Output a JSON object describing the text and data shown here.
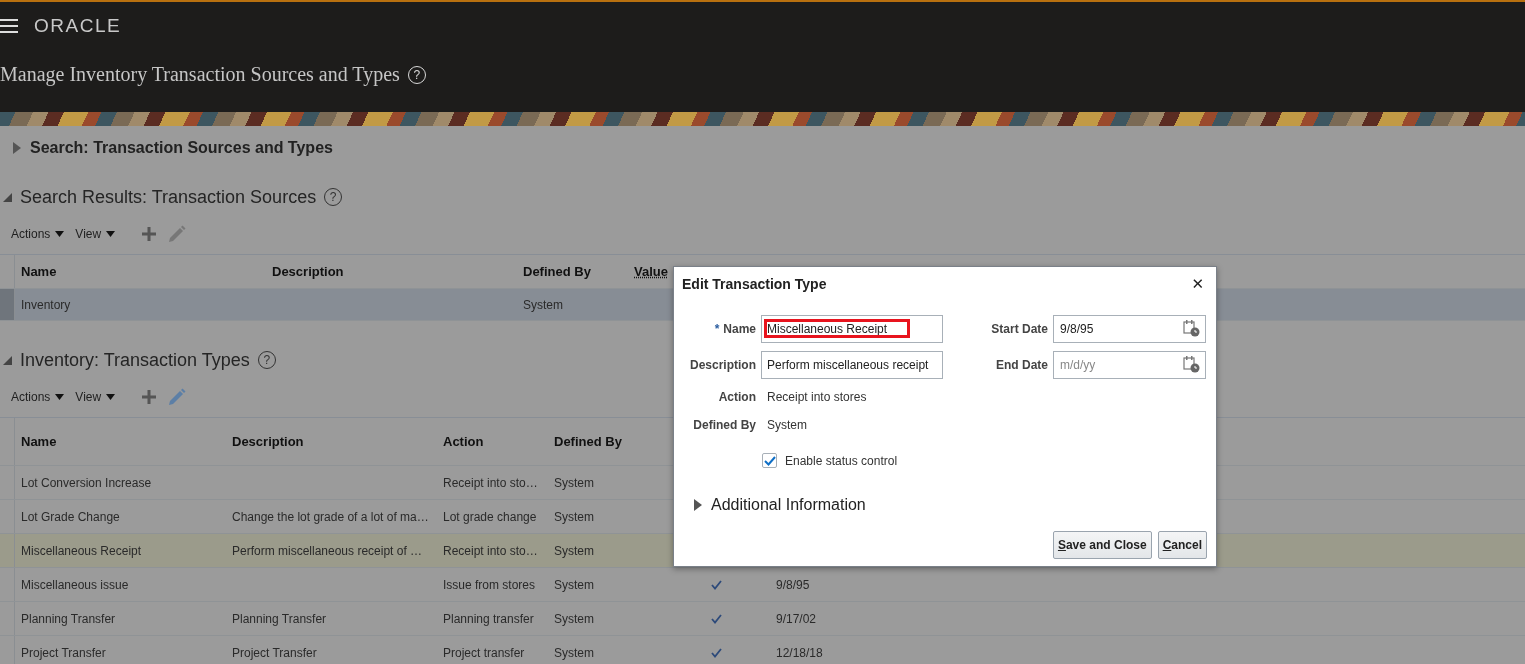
{
  "header": {
    "logo": "ORACLE",
    "page_title": "Manage Inventory Transaction Sources and Types",
    "help": "?"
  },
  "search_section": {
    "title": "Search: Transaction Sources and Types",
    "expanded": false
  },
  "sources": {
    "title": "Search Results: Transaction Sources",
    "help": "?",
    "expanded": true,
    "toolbar": [
      "Actions",
      "View"
    ],
    "columns": [
      "Name",
      "Description",
      "Defined By",
      "Value"
    ],
    "rows": [
      {
        "cells": [
          "Inventory",
          "",
          "System",
          ""
        ],
        "selected": true
      }
    ]
  },
  "types": {
    "title": "Inventory: Transaction Types",
    "help": "?",
    "expanded": true,
    "toolbar": [
      "Actions",
      "View"
    ],
    "columns": [
      "Name",
      "Description",
      "Action",
      "Defined By",
      "",
      ""
    ],
    "rows": [
      {
        "cells": [
          "Lot Conversion Increase",
          "",
          "Receipt into sto…",
          "System"
        ],
        "selected": false
      },
      {
        "cells": [
          "Lot Grade Change",
          "Change the lot grade of a lot of ma…",
          "Lot grade change",
          "System"
        ],
        "selected": false
      },
      {
        "cells": [
          "Miscellaneous Receipt",
          "Perform miscellaneous receipt of …",
          "Receipt into sto…",
          "System"
        ],
        "selected": true
      },
      {
        "cells": [
          "Miscellaneous issue",
          "",
          "Issue from stores",
          "System"
        ],
        "selected": false,
        "status_control": true,
        "start_date": "9/8/95"
      },
      {
        "cells": [
          "Planning Transfer",
          "Planning Transfer",
          "Planning transfer",
          "System"
        ],
        "selected": false,
        "status_control": true,
        "start_date": "9/17/02"
      },
      {
        "cells": [
          "Project Transfer",
          "Project Transfer",
          "Project transfer",
          "System"
        ],
        "selected": false,
        "status_control": true,
        "start_date": "12/18/18"
      }
    ]
  },
  "dialog": {
    "title": "Edit Transaction Type",
    "close": "✕",
    "name": {
      "label": "Name",
      "required_mark": "*",
      "value": "Miscellaneous Receipt",
      "highlighted": true
    },
    "description": {
      "label": "Description",
      "value": "Perform miscellaneous receipt"
    },
    "action": {
      "label": "Action",
      "value": "Receipt into stores"
    },
    "defined_by": {
      "label": "Defined By",
      "value": "System"
    },
    "start_date": {
      "label": "Start Date",
      "value": "9/8/95"
    },
    "end_date": {
      "label": "End Date",
      "placeholder": "m/d/yy"
    },
    "status_control": {
      "label": "Enable status control",
      "checked": true
    },
    "additional": {
      "title": "Additional Information",
      "expanded": false
    },
    "buttons": [
      {
        "label": "Save and Close"
      },
      {
        "label": "Cancel"
      }
    ]
  }
}
